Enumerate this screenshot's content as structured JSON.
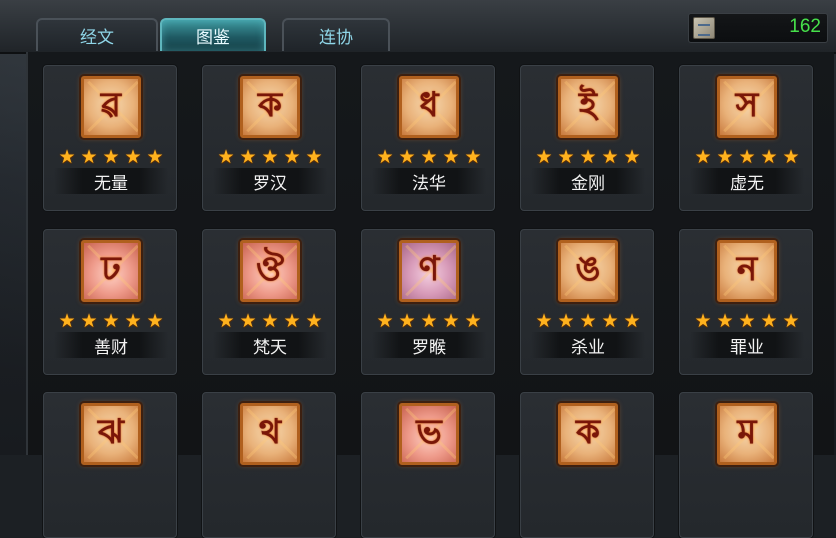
{
  "tabs": [
    {
      "label": "经文",
      "active": false
    },
    {
      "label": "图鉴",
      "active": true
    },
    {
      "label": "连协",
      "active": false
    }
  ],
  "currency": {
    "icon": "scroll-icon",
    "value": "162",
    "color": "#46e04a"
  },
  "cards": [
    {
      "name": "无量",
      "glyph": "ৱ",
      "stars": 5,
      "tint": "orange"
    },
    {
      "name": "罗汉",
      "glyph": "ক",
      "stars": 5,
      "tint": "orange"
    },
    {
      "name": "法华",
      "glyph": "ধ",
      "stars": 5,
      "tint": "orange"
    },
    {
      "name": "金刚",
      "glyph": "ই",
      "stars": 5,
      "tint": "orange"
    },
    {
      "name": "虚无",
      "glyph": "স",
      "stars": 5,
      "tint": "orange"
    },
    {
      "name": "善财",
      "glyph": "ঢ",
      "stars": 5,
      "tint": "pink"
    },
    {
      "name": "梵天",
      "glyph": "ঔ",
      "stars": 5,
      "tint": "pink"
    },
    {
      "name": "罗睺",
      "glyph": "ণ",
      "stars": 5,
      "tint": "violet"
    },
    {
      "name": "杀业",
      "glyph": "ঙ",
      "stars": 5,
      "tint": "orange"
    },
    {
      "name": "罪业",
      "glyph": "ন",
      "stars": 5,
      "tint": "orange"
    },
    {
      "name": "",
      "glyph": "ঝ",
      "stars": 0,
      "tint": "orange"
    },
    {
      "name": "",
      "glyph": "থ",
      "stars": 0,
      "tint": "orange"
    },
    {
      "name": "",
      "glyph": "ভ",
      "stars": 0,
      "tint": "pink"
    },
    {
      "name": "",
      "glyph": "ক",
      "stars": 0,
      "tint": "orange"
    },
    {
      "name": "",
      "glyph": "ম",
      "stars": 0,
      "tint": "orange"
    }
  ]
}
